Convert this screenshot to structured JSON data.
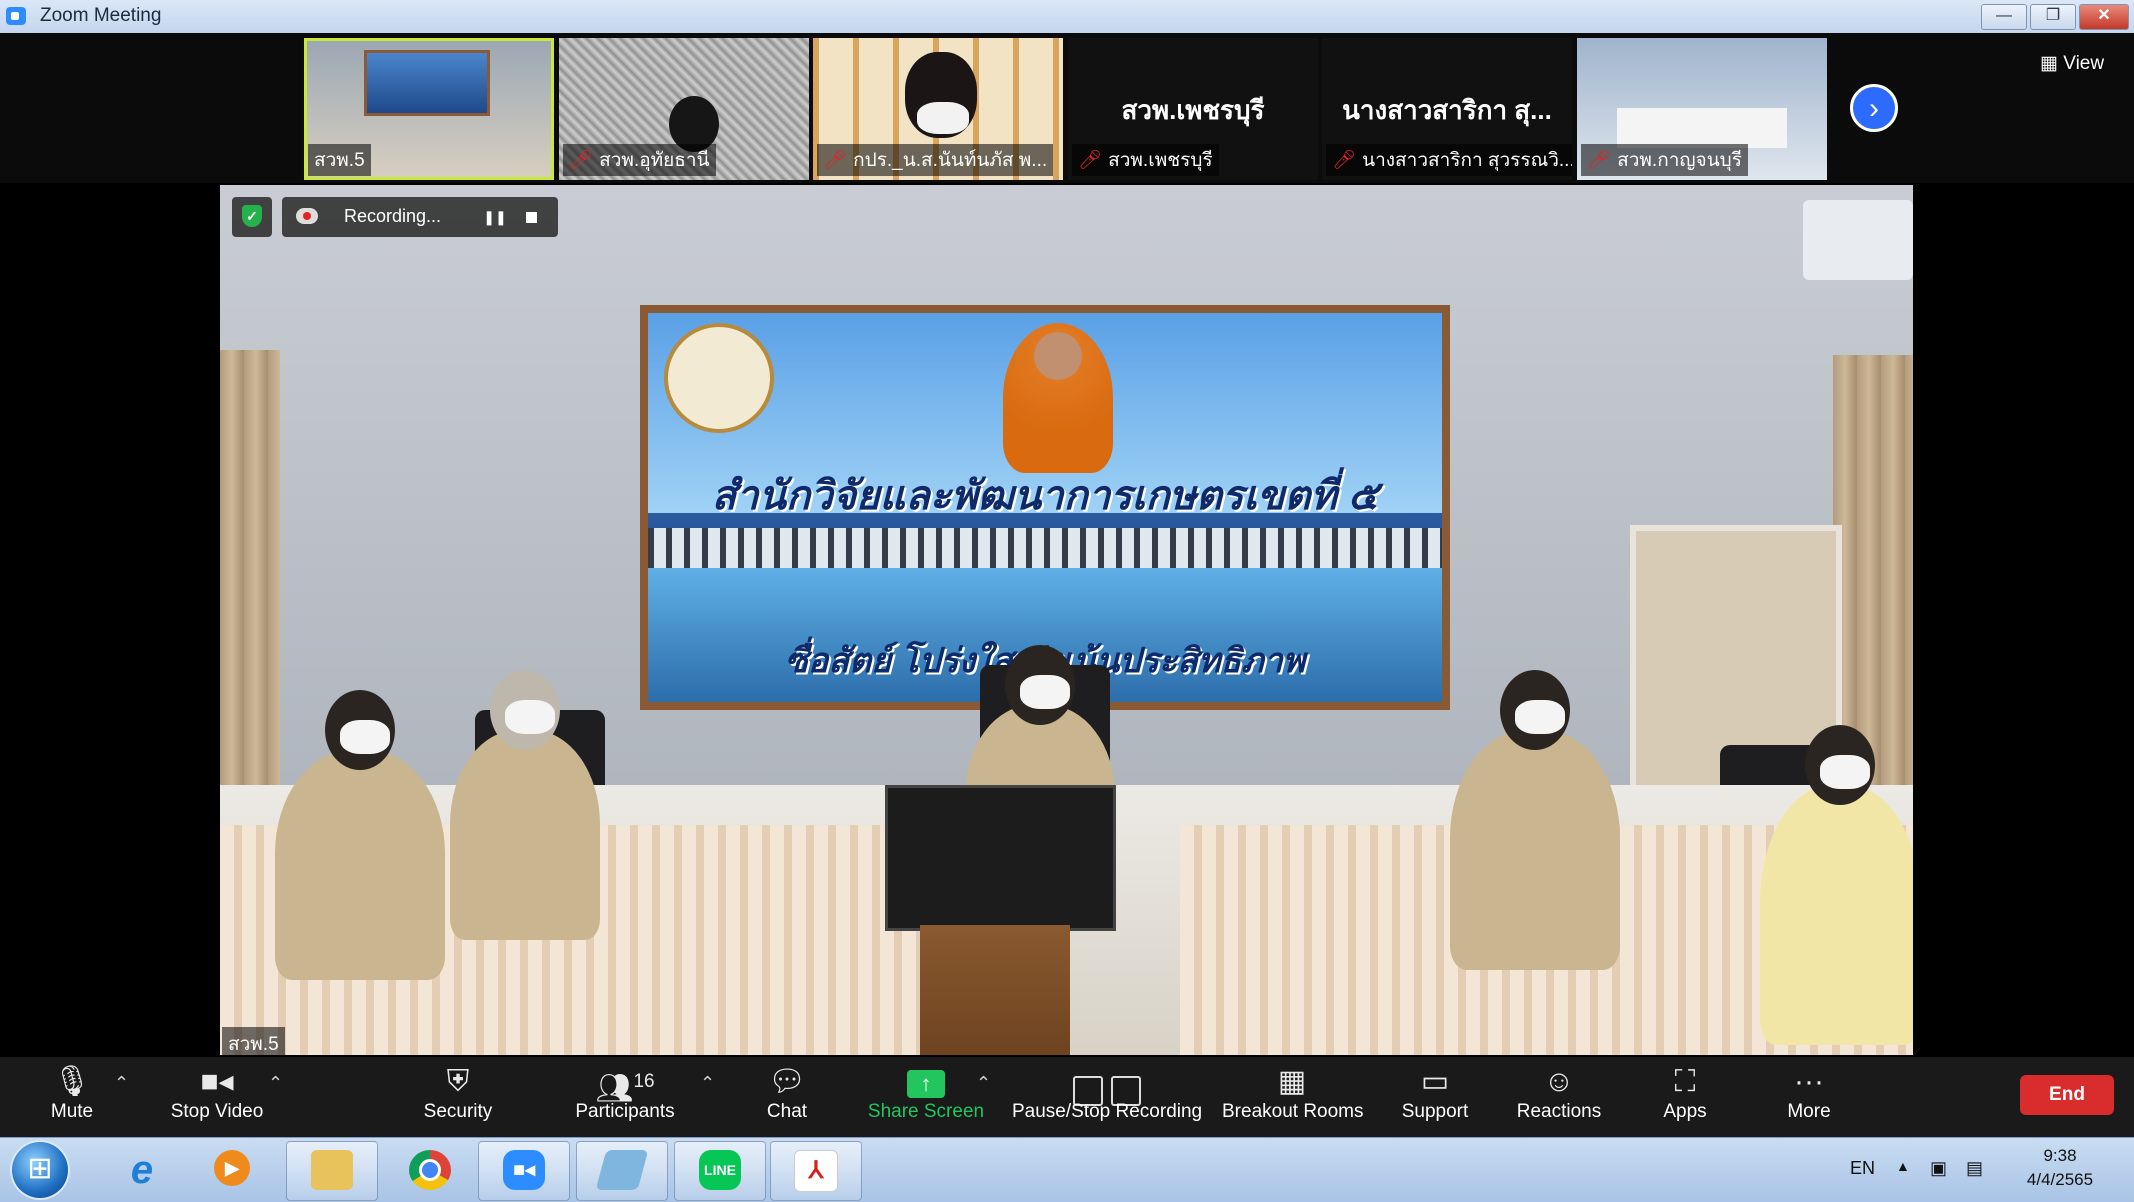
{
  "window": {
    "title": "Zoom Meeting",
    "controls": [
      "—",
      "❐",
      "✕"
    ]
  },
  "gallery": {
    "thumbnails": [
      {
        "name": "สวพ.5",
        "muted": false,
        "video": true
      },
      {
        "name": "สวพ.อุทัยธานี",
        "muted": true,
        "video": true
      },
      {
        "name": "กปร._น.ส.นันท์นภัส พ...",
        "muted": true,
        "video": true
      },
      {
        "name": "สวพ.เพชรบุรี",
        "muted": true,
        "video": false,
        "display_name": "สวพ.เพชรบุรี"
      },
      {
        "name": "นางสาวสาริกา สุวรรณวิ...",
        "muted": true,
        "video": false,
        "display_name": "นางสาวสาริกา สุ..."
      },
      {
        "name": "สวพ.กาญจนบุรี",
        "muted": true,
        "video": true
      }
    ],
    "next_icon": "chevron-right-icon",
    "view_label": "View"
  },
  "main_video": {
    "speaker_name": "สวพ.5",
    "banner_title": "สำนักวิจัยและพัฒนาการเกษตรเขตที่ ๕",
    "banner_slogan": "ซื่อสัตย์ โปร่งใส มุ่งเน้นประสิทธิภาพ",
    "security_icon": "shield-check-icon"
  },
  "recording": {
    "label": "Recording...",
    "pause_icon": "pause-icon",
    "stop_icon": "stop-icon"
  },
  "toolbar": {
    "mute": "Mute",
    "stop_video": "Stop Video",
    "security": "Security",
    "participants": "Participants",
    "participants_count": "16",
    "chat": "Chat",
    "share_screen": "Share Screen",
    "pause_stop_recording": "Pause/Stop Recording",
    "breakout_rooms": "Breakout Rooms",
    "support": "Support",
    "reactions": "Reactions",
    "apps": "Apps",
    "more": "More",
    "end": "End"
  },
  "taskbar": {
    "apps": [
      "internet-explorer-icon",
      "media-player-icon",
      "file-explorer-icon",
      "chrome-icon",
      "zoom-icon",
      "notepad-icon",
      "line-icon",
      "acrobat-icon"
    ],
    "line_label": "LINE",
    "language": "EN",
    "time": "9:38",
    "date": "4/4/2565"
  },
  "colors": {
    "accent": "#2d8cff",
    "end": "#d92d2d",
    "share": "#22c55e",
    "muted_mic": "#e02424"
  }
}
